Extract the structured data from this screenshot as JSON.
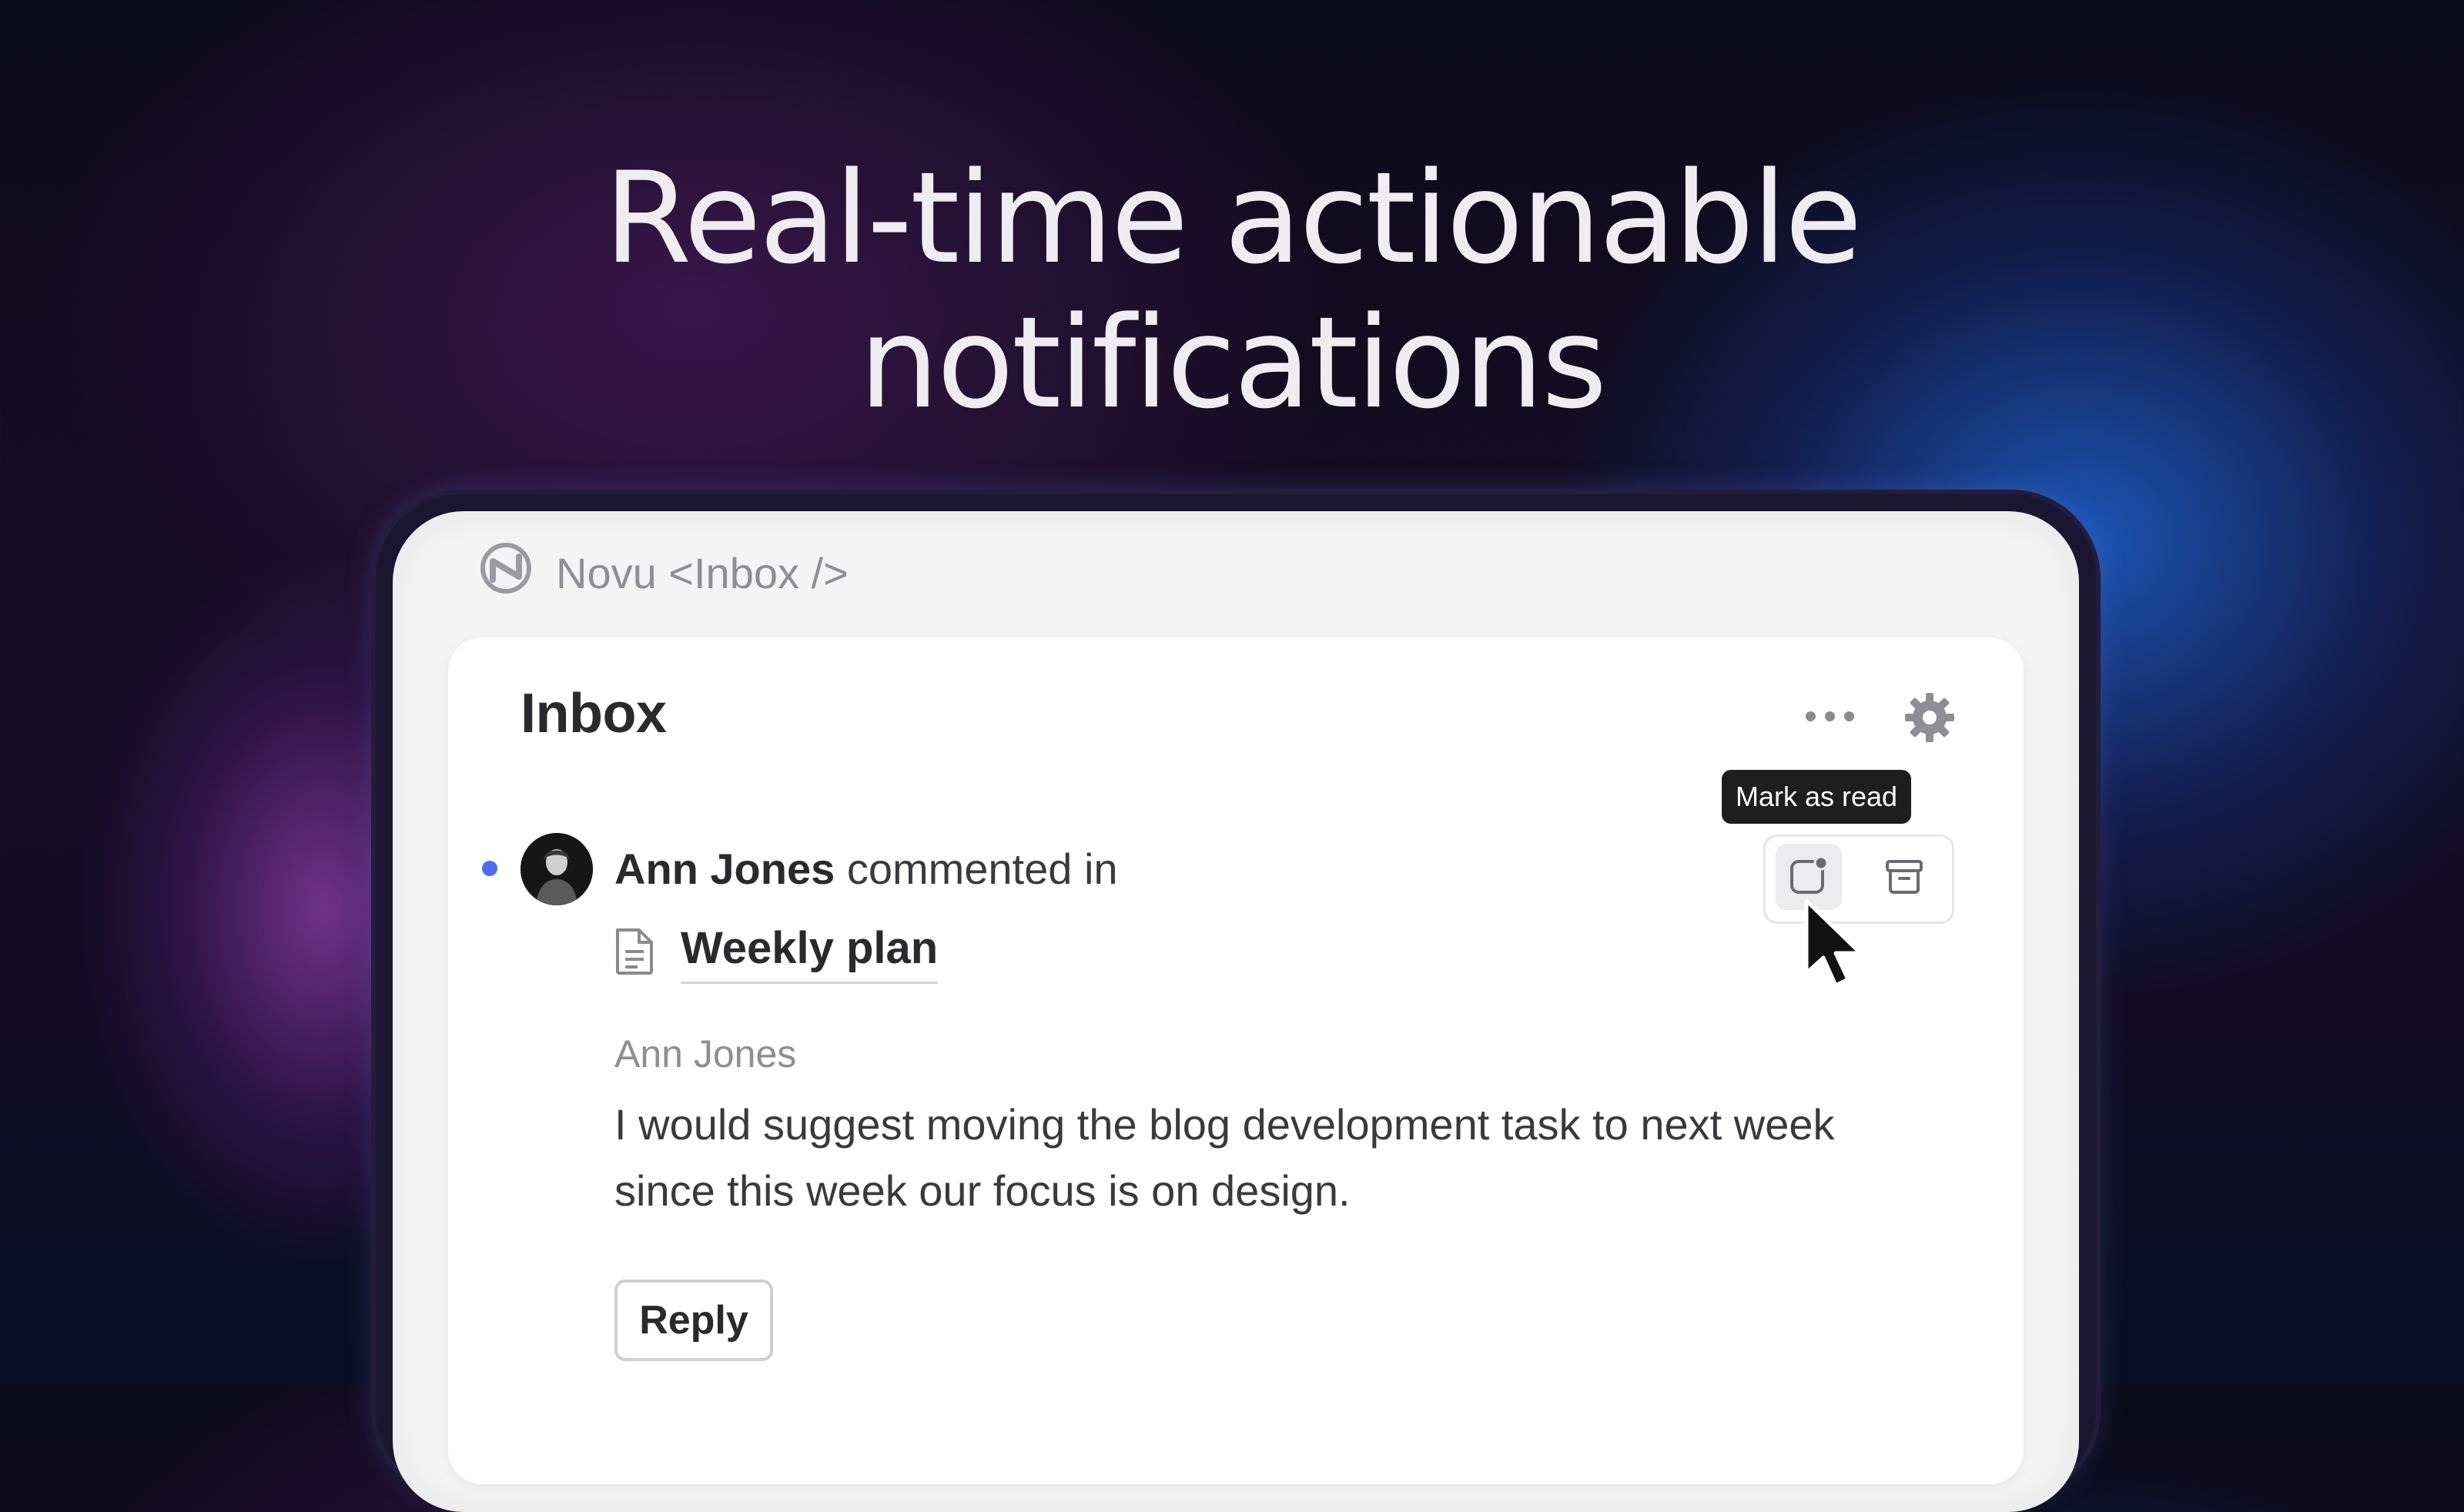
{
  "headline": {
    "line1": "Real-time actionable",
    "line2": "notifications"
  },
  "brand": {
    "logo_icon": "novu-logo-icon",
    "label": "Novu <Inbox />"
  },
  "inbox": {
    "title": "Inbox",
    "more_icon": "ellipsis-icon",
    "settings_icon": "gear-icon"
  },
  "notification": {
    "unread": true,
    "unread_color": "#4f6cf0",
    "actor": "Ann Jones",
    "action_text": " commented in",
    "document_icon": "document-icon",
    "document_title": "Weekly plan",
    "author": "Ann Jones",
    "message": "I would suggest moving the blog development task to next week since this week our focus is on design.",
    "reply_label": "Reply",
    "tooltip": "Mark as read",
    "mark_read_icon": "mark-read-icon",
    "archive_icon": "archive-icon"
  },
  "colors": {
    "accent_blue": "#4f6cf0",
    "tooltip_bg": "#1e1e1e"
  }
}
